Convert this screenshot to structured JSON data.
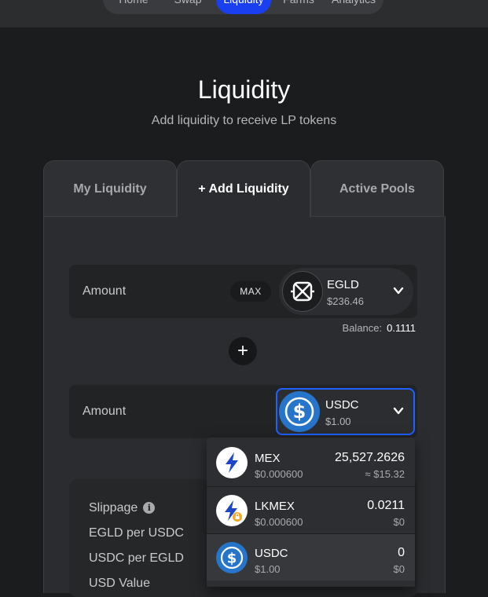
{
  "nav": {
    "items": [
      {
        "label": "Home"
      },
      {
        "label": "Swap"
      },
      {
        "label": "Liquidity",
        "active": true
      },
      {
        "label": "Farms"
      },
      {
        "label": "Analytics"
      }
    ]
  },
  "page": {
    "title": "Liquidity",
    "subtitle": "Add liquidity to receive LP tokens"
  },
  "tabs": [
    {
      "label": "My Liquidity"
    },
    {
      "label": "+ Add Liquidity",
      "active": true
    },
    {
      "label": "Active Pools"
    }
  ],
  "first_input": {
    "label": "Amount",
    "max_label": "MAX",
    "token": {
      "name": "EGLD",
      "price": "$236.46",
      "icon": "egld-icon"
    },
    "balance_label": "Balance:",
    "balance_value": "0.1111"
  },
  "plus_symbol": "+",
  "second_input": {
    "label": "Amount",
    "token": {
      "name": "USDC",
      "price": "$1.00",
      "icon": "usdc-icon"
    }
  },
  "info": {
    "rows": [
      {
        "label": "Slippage"
      },
      {
        "label": "EGLD per USDC"
      },
      {
        "label": "USDC per EGLD"
      },
      {
        "label": "USD Value"
      }
    ],
    "info_glyph": "i"
  },
  "dropdown": {
    "items": [
      {
        "name": "MEX",
        "price": "$0.000600",
        "balance": "25,527.2626",
        "value": "≈ $15.32",
        "icon": "mex-icon"
      },
      {
        "name": "LKMEX",
        "price": "$0.000600",
        "balance": "0.0211",
        "value": "$0",
        "icon": "lkmex-icon"
      },
      {
        "name": "USDC",
        "price": "$1.00",
        "balance": "0",
        "value": "$0",
        "icon": "usdc-icon",
        "highlighted": true
      }
    ]
  },
  "colors": {
    "accent": "#1a3ff0",
    "focus_border": "#1f62ff",
    "usdc_blue": "#2775ca",
    "background": "#1b1c1e"
  }
}
